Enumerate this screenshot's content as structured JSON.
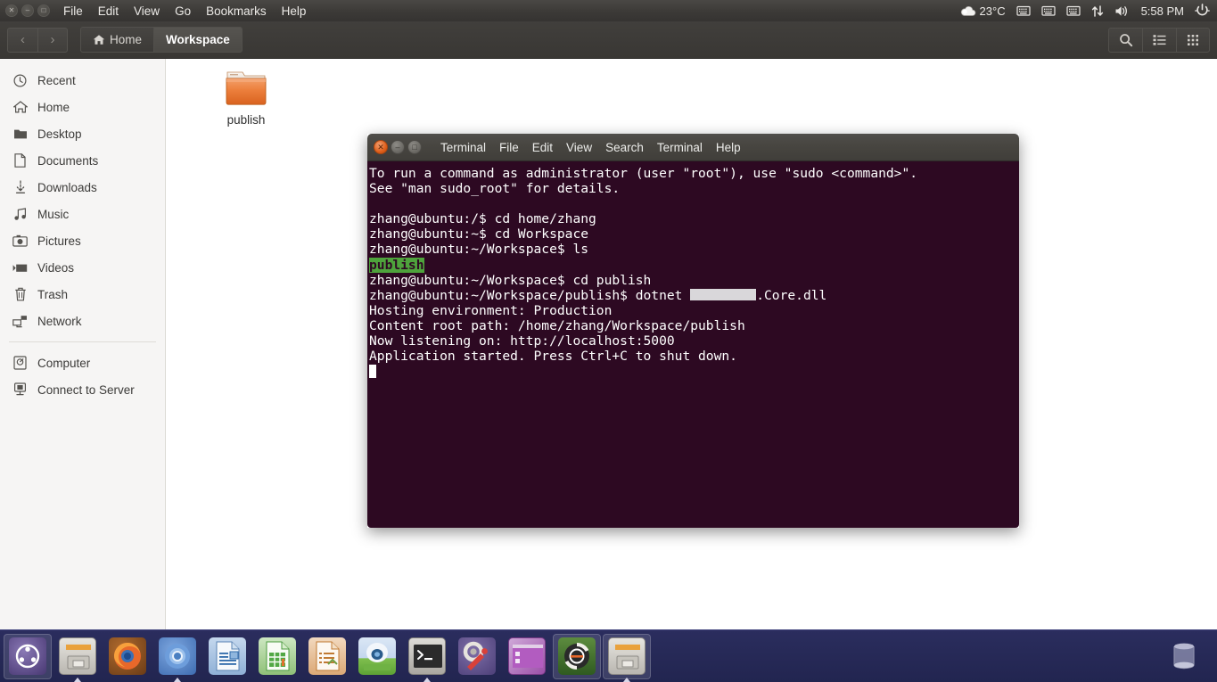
{
  "top_panel": {
    "window_controls": [
      "close",
      "minimize",
      "maximize"
    ],
    "menu": [
      "File",
      "Edit",
      "View",
      "Go",
      "Bookmarks",
      "Help"
    ],
    "indicators": {
      "weather_icon": "cloud-icon",
      "temperature": "23°C",
      "keyboard_icon_1": "keyboard-icon",
      "keyboard_icon_2": "keyboard-icon",
      "keyboard_icon_3": "keyboard-icon",
      "network_icon": "network-updown-icon",
      "volume_icon": "volume-icon",
      "clock": "5:58 PM",
      "power_icon": "power-gear-icon"
    }
  },
  "nautilus": {
    "nav": {
      "back": "‹",
      "forward": "›"
    },
    "breadcrumbs": [
      {
        "label": "Home",
        "icon": "home-icon",
        "active": false
      },
      {
        "label": "Workspace",
        "icon": "",
        "active": true
      }
    ],
    "header_icons": [
      "search-icon",
      "list-view-icon",
      "grid-view-icon"
    ],
    "sidebar": {
      "items": [
        {
          "label": "Recent",
          "icon": "clock-icon"
        },
        {
          "label": "Home",
          "icon": "home-icon"
        },
        {
          "label": "Desktop",
          "icon": "folder-icon"
        },
        {
          "label": "Documents",
          "icon": "document-icon"
        },
        {
          "label": "Downloads",
          "icon": "download-icon"
        },
        {
          "label": "Music",
          "icon": "music-icon"
        },
        {
          "label": "Pictures",
          "icon": "camera-icon"
        },
        {
          "label": "Videos",
          "icon": "video-icon"
        },
        {
          "label": "Trash",
          "icon": "trash-icon"
        },
        {
          "label": "Network",
          "icon": "network-icon"
        }
      ],
      "items2": [
        {
          "label": "Computer",
          "icon": "computer-icon"
        },
        {
          "label": "Connect to Server",
          "icon": "server-icon"
        }
      ]
    },
    "files": [
      {
        "name": "publish",
        "type": "folder",
        "color": "#e8732c"
      }
    ]
  },
  "terminal": {
    "window_controls": [
      "close",
      "minimize",
      "maximize"
    ],
    "menu": [
      "Terminal",
      "File",
      "Edit",
      "View",
      "Search",
      "Terminal",
      "Help"
    ],
    "colors": {
      "background": "#2d0922",
      "foreground": "#ffffff",
      "dir_highlight": "#4ea33c"
    },
    "lines": [
      {
        "kind": "text",
        "text": "To run a command as administrator (user \"root\"), use \"sudo <command>\"."
      },
      {
        "kind": "text",
        "text": "See \"man sudo_root\" for details."
      },
      {
        "kind": "text",
        "text": ""
      },
      {
        "kind": "text",
        "text": "zhang@ubuntu:/$ cd home/zhang"
      },
      {
        "kind": "text",
        "text": "zhang@ubuntu:~$ cd Workspace"
      },
      {
        "kind": "text",
        "text": "zhang@ubuntu:~/Workspace$ ls"
      },
      {
        "kind": "dir",
        "text": "publish"
      },
      {
        "kind": "text",
        "text": "zhang@ubuntu:~/Workspace$ cd publish"
      },
      {
        "kind": "redacted",
        "prefix": "zhang@ubuntu:~/Workspace/publish$ dotnet ",
        "suffix": ".Core.dll"
      },
      {
        "kind": "text",
        "text": "Hosting environment: Production"
      },
      {
        "kind": "text",
        "text": "Content root path: /home/zhang/Workspace/publish"
      },
      {
        "kind": "text",
        "text": "Now listening on: http://localhost:5000"
      },
      {
        "kind": "text",
        "text": "Application started. Press Ctrl+C to shut down."
      },
      {
        "kind": "cursor",
        "text": ""
      }
    ]
  },
  "launcher": {
    "items": [
      {
        "name": "ubuntu-dash-icon",
        "label": "Ubuntu Dash"
      },
      {
        "name": "files-icon",
        "label": "Files"
      },
      {
        "name": "firefox-icon",
        "label": "Firefox"
      },
      {
        "name": "chromium-icon",
        "label": "Chromium"
      },
      {
        "name": "libreoffice-writer-icon",
        "label": "LibreOffice Writer"
      },
      {
        "name": "libreoffice-calc-icon",
        "label": "LibreOffice Calc"
      },
      {
        "name": "libreoffice-impress-icon",
        "label": "LibreOffice Impress"
      },
      {
        "name": "software-center-icon",
        "label": "Ubuntu Software"
      },
      {
        "name": "terminal-icon",
        "label": "Terminal"
      },
      {
        "name": "system-settings-icon",
        "label": "System Settings"
      },
      {
        "name": "workspace-switcher-icon",
        "label": "Workspace Switcher"
      },
      {
        "name": "software-updater-icon",
        "label": "Software Updater"
      },
      {
        "name": "files-window-icon",
        "label": "Files"
      }
    ],
    "trash": {
      "name": "trash-icon",
      "label": "Trash"
    }
  }
}
